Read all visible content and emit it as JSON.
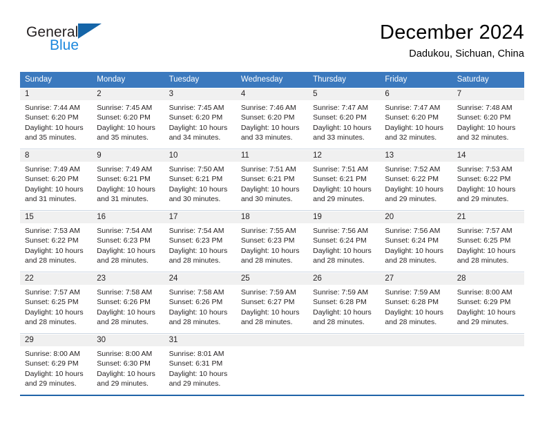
{
  "brand": {
    "name_top": "General",
    "name_bottom": "Blue",
    "triangle_color": "#1565a8",
    "top_color": "#231f20",
    "bottom_color": "#1b87dd"
  },
  "header": {
    "title": "December 2024",
    "subtitle": "Dadukou, Sichuan, China"
  },
  "colors": {
    "header_row_bg": "#3b79be",
    "header_row_text": "#ffffff",
    "daynum_band_bg": "#f0f0f0",
    "row_separator": "#ccd6e2",
    "row_separator_strong": "#1f63a8",
    "body_text": "#231f20"
  },
  "weekday_headers": [
    "Sunday",
    "Monday",
    "Tuesday",
    "Wednesday",
    "Thursday",
    "Friday",
    "Saturday"
  ],
  "weeks": [
    [
      {
        "day": "1",
        "sunrise": "Sunrise: 7:44 AM",
        "sunset": "Sunset: 6:20 PM",
        "daylight_1": "Daylight: 10 hours",
        "daylight_2": "and 35 minutes."
      },
      {
        "day": "2",
        "sunrise": "Sunrise: 7:45 AM",
        "sunset": "Sunset: 6:20 PM",
        "daylight_1": "Daylight: 10 hours",
        "daylight_2": "and 35 minutes."
      },
      {
        "day": "3",
        "sunrise": "Sunrise: 7:45 AM",
        "sunset": "Sunset: 6:20 PM",
        "daylight_1": "Daylight: 10 hours",
        "daylight_2": "and 34 minutes."
      },
      {
        "day": "4",
        "sunrise": "Sunrise: 7:46 AM",
        "sunset": "Sunset: 6:20 PM",
        "daylight_1": "Daylight: 10 hours",
        "daylight_2": "and 33 minutes."
      },
      {
        "day": "5",
        "sunrise": "Sunrise: 7:47 AM",
        "sunset": "Sunset: 6:20 PM",
        "daylight_1": "Daylight: 10 hours",
        "daylight_2": "and 33 minutes."
      },
      {
        "day": "6",
        "sunrise": "Sunrise: 7:47 AM",
        "sunset": "Sunset: 6:20 PM",
        "daylight_1": "Daylight: 10 hours",
        "daylight_2": "and 32 minutes."
      },
      {
        "day": "7",
        "sunrise": "Sunrise: 7:48 AM",
        "sunset": "Sunset: 6:20 PM",
        "daylight_1": "Daylight: 10 hours",
        "daylight_2": "and 32 minutes."
      }
    ],
    [
      {
        "day": "8",
        "sunrise": "Sunrise: 7:49 AM",
        "sunset": "Sunset: 6:20 PM",
        "daylight_1": "Daylight: 10 hours",
        "daylight_2": "and 31 minutes."
      },
      {
        "day": "9",
        "sunrise": "Sunrise: 7:49 AM",
        "sunset": "Sunset: 6:21 PM",
        "daylight_1": "Daylight: 10 hours",
        "daylight_2": "and 31 minutes."
      },
      {
        "day": "10",
        "sunrise": "Sunrise: 7:50 AM",
        "sunset": "Sunset: 6:21 PM",
        "daylight_1": "Daylight: 10 hours",
        "daylight_2": "and 30 minutes."
      },
      {
        "day": "11",
        "sunrise": "Sunrise: 7:51 AM",
        "sunset": "Sunset: 6:21 PM",
        "daylight_1": "Daylight: 10 hours",
        "daylight_2": "and 30 minutes."
      },
      {
        "day": "12",
        "sunrise": "Sunrise: 7:51 AM",
        "sunset": "Sunset: 6:21 PM",
        "daylight_1": "Daylight: 10 hours",
        "daylight_2": "and 29 minutes."
      },
      {
        "day": "13",
        "sunrise": "Sunrise: 7:52 AM",
        "sunset": "Sunset: 6:22 PM",
        "daylight_1": "Daylight: 10 hours",
        "daylight_2": "and 29 minutes."
      },
      {
        "day": "14",
        "sunrise": "Sunrise: 7:53 AM",
        "sunset": "Sunset: 6:22 PM",
        "daylight_1": "Daylight: 10 hours",
        "daylight_2": "and 29 minutes."
      }
    ],
    [
      {
        "day": "15",
        "sunrise": "Sunrise: 7:53 AM",
        "sunset": "Sunset: 6:22 PM",
        "daylight_1": "Daylight: 10 hours",
        "daylight_2": "and 28 minutes."
      },
      {
        "day": "16",
        "sunrise": "Sunrise: 7:54 AM",
        "sunset": "Sunset: 6:23 PM",
        "daylight_1": "Daylight: 10 hours",
        "daylight_2": "and 28 minutes."
      },
      {
        "day": "17",
        "sunrise": "Sunrise: 7:54 AM",
        "sunset": "Sunset: 6:23 PM",
        "daylight_1": "Daylight: 10 hours",
        "daylight_2": "and 28 minutes."
      },
      {
        "day": "18",
        "sunrise": "Sunrise: 7:55 AM",
        "sunset": "Sunset: 6:23 PM",
        "daylight_1": "Daylight: 10 hours",
        "daylight_2": "and 28 minutes."
      },
      {
        "day": "19",
        "sunrise": "Sunrise: 7:56 AM",
        "sunset": "Sunset: 6:24 PM",
        "daylight_1": "Daylight: 10 hours",
        "daylight_2": "and 28 minutes."
      },
      {
        "day": "20",
        "sunrise": "Sunrise: 7:56 AM",
        "sunset": "Sunset: 6:24 PM",
        "daylight_1": "Daylight: 10 hours",
        "daylight_2": "and 28 minutes."
      },
      {
        "day": "21",
        "sunrise": "Sunrise: 7:57 AM",
        "sunset": "Sunset: 6:25 PM",
        "daylight_1": "Daylight: 10 hours",
        "daylight_2": "and 28 minutes."
      }
    ],
    [
      {
        "day": "22",
        "sunrise": "Sunrise: 7:57 AM",
        "sunset": "Sunset: 6:25 PM",
        "daylight_1": "Daylight: 10 hours",
        "daylight_2": "and 28 minutes."
      },
      {
        "day": "23",
        "sunrise": "Sunrise: 7:58 AM",
        "sunset": "Sunset: 6:26 PM",
        "daylight_1": "Daylight: 10 hours",
        "daylight_2": "and 28 minutes."
      },
      {
        "day": "24",
        "sunrise": "Sunrise: 7:58 AM",
        "sunset": "Sunset: 6:26 PM",
        "daylight_1": "Daylight: 10 hours",
        "daylight_2": "and 28 minutes."
      },
      {
        "day": "25",
        "sunrise": "Sunrise: 7:59 AM",
        "sunset": "Sunset: 6:27 PM",
        "daylight_1": "Daylight: 10 hours",
        "daylight_2": "and 28 minutes."
      },
      {
        "day": "26",
        "sunrise": "Sunrise: 7:59 AM",
        "sunset": "Sunset: 6:28 PM",
        "daylight_1": "Daylight: 10 hours",
        "daylight_2": "and 28 minutes."
      },
      {
        "day": "27",
        "sunrise": "Sunrise: 7:59 AM",
        "sunset": "Sunset: 6:28 PM",
        "daylight_1": "Daylight: 10 hours",
        "daylight_2": "and 28 minutes."
      },
      {
        "day": "28",
        "sunrise": "Sunrise: 8:00 AM",
        "sunset": "Sunset: 6:29 PM",
        "daylight_1": "Daylight: 10 hours",
        "daylight_2": "and 29 minutes."
      }
    ],
    [
      {
        "day": "29",
        "sunrise": "Sunrise: 8:00 AM",
        "sunset": "Sunset: 6:29 PM",
        "daylight_1": "Daylight: 10 hours",
        "daylight_2": "and 29 minutes."
      },
      {
        "day": "30",
        "sunrise": "Sunrise: 8:00 AM",
        "sunset": "Sunset: 6:30 PM",
        "daylight_1": "Daylight: 10 hours",
        "daylight_2": "and 29 minutes."
      },
      {
        "day": "31",
        "sunrise": "Sunrise: 8:01 AM",
        "sunset": "Sunset: 6:31 PM",
        "daylight_1": "Daylight: 10 hours",
        "daylight_2": "and 29 minutes."
      },
      {
        "day": "",
        "sunrise": "",
        "sunset": "",
        "daylight_1": "",
        "daylight_2": ""
      },
      {
        "day": "",
        "sunrise": "",
        "sunset": "",
        "daylight_1": "",
        "daylight_2": ""
      },
      {
        "day": "",
        "sunrise": "",
        "sunset": "",
        "daylight_1": "",
        "daylight_2": ""
      },
      {
        "day": "",
        "sunrise": "",
        "sunset": "",
        "daylight_1": "",
        "daylight_2": ""
      }
    ]
  ]
}
